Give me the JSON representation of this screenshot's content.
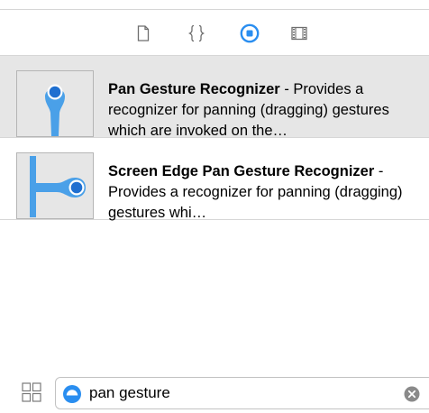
{
  "inspector_tabs": [
    {
      "icon": "file-icon",
      "selected": false
    },
    {
      "icon": "code-braces-icon",
      "selected": false
    },
    {
      "icon": "object-library-icon",
      "selected": true
    },
    {
      "icon": "media-library-icon",
      "selected": false
    }
  ],
  "library": {
    "items": [
      {
        "title": "Pan Gesture Recognizer",
        "separator": " - ",
        "description": "Provides a recognizer for panning (dragging) gestures which are invoked on the…",
        "icon": "pan-gesture-icon",
        "selected": true
      },
      {
        "title": "Screen Edge Pan Gesture Recognizer",
        "separator": " - ",
        "description": "Provides a recognizer for panning (dragging) gestures whi…",
        "icon": "screen-edge-pan-gesture-icon",
        "selected": false
      }
    ]
  },
  "search": {
    "value": "pan gesture"
  },
  "colors": {
    "accent": "#2a8ef0",
    "gesture_blue": "#4aa0e8",
    "selected_row": "#e6e6e6"
  }
}
